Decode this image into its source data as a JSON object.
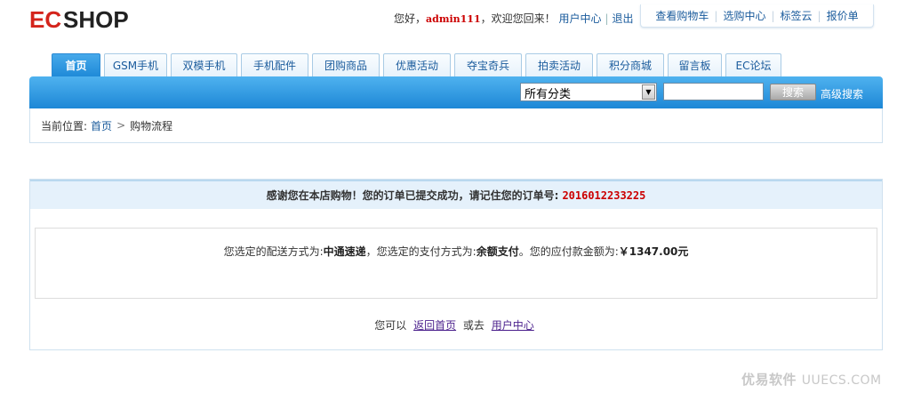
{
  "header": {
    "logo_text": "ECSHOP",
    "greeting": "您好，",
    "username": "admin111",
    "welcome_back": "，欢迎您回来！",
    "user_center": "用户中心",
    "logout": "退出",
    "links": [
      "查看购物车",
      "选购中心",
      "标签云",
      "报价单"
    ]
  },
  "nav": {
    "tabs": [
      {
        "label": "首页",
        "active": true
      },
      {
        "label": "GSM手机",
        "active": false
      },
      {
        "label": "双模手机",
        "active": false
      },
      {
        "label": "手机配件",
        "active": false
      },
      {
        "label": "团购商品",
        "active": false
      },
      {
        "label": "优惠活动",
        "active": false
      },
      {
        "label": "夺宝奇兵",
        "active": false
      },
      {
        "label": "拍卖活动",
        "active": false
      },
      {
        "label": "积分商城",
        "active": false
      },
      {
        "label": "留言板",
        "active": false
      },
      {
        "label": "EC论坛",
        "active": false
      }
    ]
  },
  "search": {
    "category_selected": "所有分类",
    "keyword_value": "",
    "button_label": "搜索",
    "advanced_label": "高级搜索"
  },
  "breadcrumb": {
    "prefix": "当前位置:",
    "home": "首页",
    "current": "购物流程"
  },
  "order": {
    "thanks_text": "感谢您在本店购物！您的订单已提交成功，请记住您的订单号:",
    "order_number": "2016012233225",
    "shipping_prefix": "您选定的配送方式为:",
    "shipping_method": "中通速递",
    "payment_prefix": "，您选定的支付方式为:",
    "payment_method": "余额支付",
    "amount_prefix": "。您的应付款金额为:",
    "amount": "￥1347.00元",
    "footer_prefix": "您可以",
    "back_home": "返回首页",
    "or_go": "或去",
    "user_center": "用户中心"
  },
  "watermark": {
    "brand": "优易软件",
    "site": "UUECS.COM"
  },
  "colors": {
    "brand_blue": "#1d87d6",
    "link_blue": "#1a5b9c",
    "highlight_red": "#cc0000"
  }
}
